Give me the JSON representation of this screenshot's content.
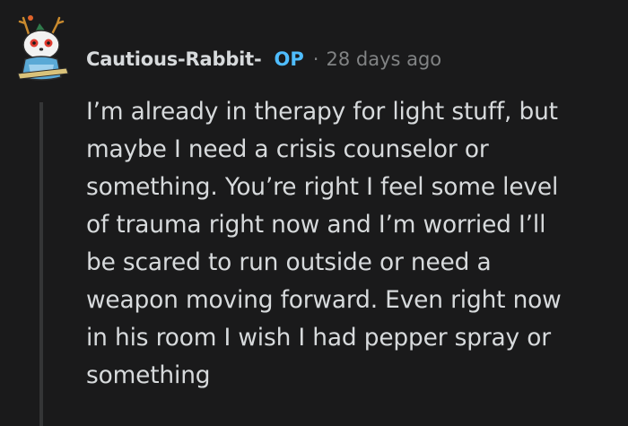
{
  "comment": {
    "author": "Cautious-Rabbit-",
    "op_badge": "OP",
    "separator": "·",
    "timestamp": "28 days ago",
    "avatar_icon": "snoo-avatar-icon",
    "body_lines": [
      "I’m already in therapy for light stuff, but",
      "maybe I need a crisis counselor or",
      "something. You’re right I feel some level",
      "of trauma right now and I’m worried I’ll",
      "be scared to run outside or need a",
      "weapon moving forward. Even right now",
      "in his room I wish I had pepper spray or",
      "something"
    ]
  },
  "colors": {
    "background": "#1a1a1b",
    "text": "#d7dadc",
    "op_badge": "#4fbdff",
    "meta": "#818384",
    "thread_line": "#343536"
  }
}
